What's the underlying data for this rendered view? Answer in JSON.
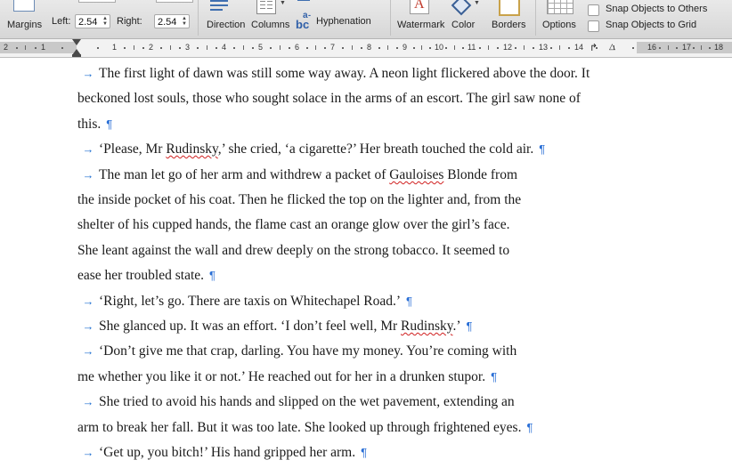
{
  "ribbon": {
    "margins_label": "Margins",
    "left_label": "Left:",
    "left_value": "2.54",
    "right_label": "Right:",
    "right_value": "2.54",
    "direction_label": "Direction",
    "columns_label": "Columns",
    "hyphenation_label": "Hyphenation",
    "watermark_label": "Watermark",
    "color_label": "Color",
    "borders_label": "Borders",
    "options_label": "Options",
    "snap_others_label": "Snap Objects to Others",
    "snap_grid_label": "Snap Objects to Grid"
  },
  "ruler": {
    "numbers": [
      "2",
      "1",
      "1",
      "2",
      "3",
      "4",
      "5",
      "6",
      "7",
      "8",
      "9",
      "10",
      "11",
      "12",
      "13",
      "14",
      "16",
      "17",
      "18"
    ]
  },
  "document": {
    "lines": [
      {
        "tab": true,
        "segments": [
          {
            "t": "The first light of dawn was still some way away. A neon light flickered above the door. It"
          }
        ],
        "pilcrow": false
      },
      {
        "tab": false,
        "segments": [
          {
            "t": "beckoned lost souls, those who sought solace in the arms of an escort. The girl saw none of"
          }
        ],
        "pilcrow": false
      },
      {
        "tab": false,
        "segments": [
          {
            "t": "this."
          }
        ],
        "pilcrow": true
      },
      {
        "tab": true,
        "segments": [
          {
            "t": "‘Please, Mr "
          },
          {
            "t": "Rudinsky",
            "sq": true
          },
          {
            "t": ",’ she cried, ‘a cigarette?’ Her breath touched the cold air."
          }
        ],
        "pilcrow": true
      },
      {
        "tab": true,
        "segments": [
          {
            "t": "The man let go of her arm and withdrew a packet of "
          },
          {
            "t": "Gauloises",
            "sq": true
          },
          {
            "t": " Blonde from"
          }
        ],
        "pilcrow": false
      },
      {
        "tab": false,
        "segments": [
          {
            "t": "the inside pocket of his coat. Then he flicked the top on the lighter and, from the"
          }
        ],
        "pilcrow": false
      },
      {
        "tab": false,
        "segments": [
          {
            "t": "shelter of his cupped hands, the flame cast an orange glow over the girl’s face."
          }
        ],
        "pilcrow": false
      },
      {
        "tab": false,
        "segments": [
          {
            "t": "She leant against the wall and drew deeply on the strong tobacco. It seemed to"
          }
        ],
        "pilcrow": false
      },
      {
        "tab": false,
        "segments": [
          {
            "t": "ease her troubled state."
          }
        ],
        "pilcrow": true
      },
      {
        "tab": true,
        "segments": [
          {
            "t": "‘Right, let’s go. There are taxis on Whitechapel Road.’"
          }
        ],
        "pilcrow": true
      },
      {
        "tab": true,
        "segments": [
          {
            "t": "She glanced up. It was an effort. ‘I don’t feel well, Mr "
          },
          {
            "t": "Rudinsky",
            "sq": true
          },
          {
            "t": ".’"
          }
        ],
        "pilcrow": true
      },
      {
        "tab": true,
        "segments": [
          {
            "t": "‘Don’t give me that crap, darling. You have my money. You’re coming with"
          }
        ],
        "pilcrow": false
      },
      {
        "tab": false,
        "segments": [
          {
            "t": "me whether you like it or not.’ He reached out for her in a drunken stupor."
          }
        ],
        "pilcrow": true
      },
      {
        "tab": true,
        "segments": [
          {
            "t": "She tried to avoid his hands and slipped on the wet pavement, extending an"
          }
        ],
        "pilcrow": false
      },
      {
        "tab": false,
        "segments": [
          {
            "t": "arm to break her fall. But it was too late. She looked up through frightened eyes."
          }
        ],
        "pilcrow": true
      },
      {
        "tab": true,
        "segments": [
          {
            "t": "‘Get up, you bitch!’ His hand gripped her arm."
          }
        ],
        "pilcrow": true
      }
    ],
    "tab_glyph": "→",
    "pilcrow_glyph": "¶"
  },
  "colors": {
    "accent_blue": "#1f6fd1",
    "spell_red": "#d02020",
    "watermark_red": "#c0392b"
  }
}
